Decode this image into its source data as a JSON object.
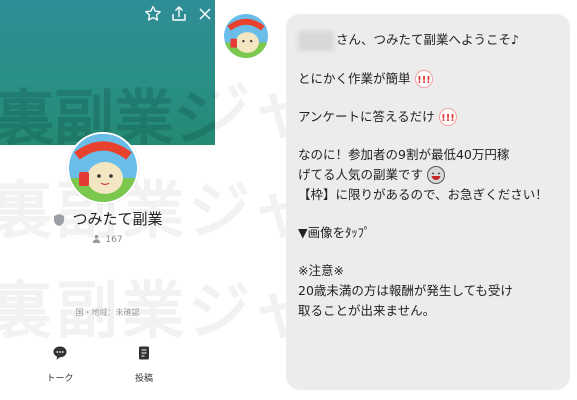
{
  "watermark": {
    "text": "裏副業ジャーニー"
  },
  "profile": {
    "name": "つみたて副業",
    "friends_count": "167",
    "region": "国・地域：未確認",
    "top_icons": [
      "star-icon",
      "share-icon",
      "close-icon"
    ],
    "actions": [
      {
        "label": "トーク",
        "icon": "chat-icon"
      },
      {
        "label": "投稿",
        "icon": "post-icon"
      }
    ]
  },
  "message": {
    "greeting": "さん、つみたて副業へようこそ♪",
    "line1": "とにかく作業が簡単",
    "line2": "アンケートに答えるだけ",
    "line3a": "なのに！参加者の9割が最低40万円稼",
    "line3b": "げてる人気の副業です",
    "line4": "【枠】に限りがあるので、お急ぎください！",
    "line5": "▼画像をﾀｯﾌﾟ",
    "line6": "※注意※",
    "line7a": "20歳未満の方は報酬が発生しても受け",
    "line7b": "取ることが出来ません。"
  },
  "colors": {
    "cover": "#2a8f86",
    "bubble": "#ececec",
    "emoji_red": "#e53935"
  }
}
